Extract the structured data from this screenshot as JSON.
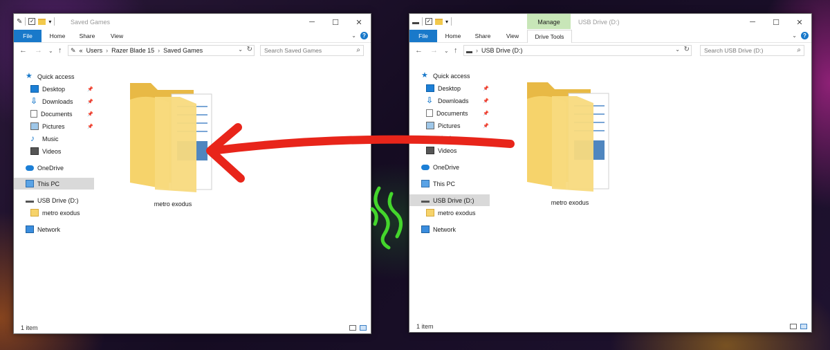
{
  "left_window": {
    "title": "Saved Games",
    "tabs": {
      "file": "File",
      "home": "Home",
      "share": "Share",
      "view": "View"
    },
    "address": {
      "overflow": "«",
      "segments": [
        "Users",
        "Razer Blade 15",
        "Saved Games"
      ]
    },
    "search_placeholder": "Search Saved Games",
    "nav": {
      "quick_access": "Quick access",
      "desktop": "Desktop",
      "downloads": "Downloads",
      "documents": "Documents",
      "pictures": "Pictures",
      "music": "Music",
      "videos": "Videos",
      "onedrive": "OneDrive",
      "this_pc": "This PC",
      "usb_drive": "USB Drive (D:)",
      "metro_exodus": "metro exodus",
      "network": "Network"
    },
    "folder_name": "metro exodus",
    "status": "1 item"
  },
  "right_window": {
    "title": "USB Drive (D:)",
    "tabs": {
      "file": "File",
      "home": "Home",
      "share": "Share",
      "view": "View",
      "manage": "Manage",
      "drive_tools": "Drive Tools"
    },
    "address": {
      "segments": [
        "USB Drive (D:)"
      ]
    },
    "search_placeholder": "Search USB Drive (D:)",
    "nav": {
      "quick_access": "Quick access",
      "desktop": "Desktop",
      "downloads": "Downloads",
      "documents": "Documents",
      "pictures": "Pictures",
      "music": "Music",
      "videos": "Videos",
      "onedrive": "OneDrive",
      "this_pc": "This PC",
      "usb_drive": "USB Drive (D:)",
      "metro_exodus": "metro exodus",
      "network": "Network"
    },
    "folder_name": "metro exodus",
    "status": "1 item"
  },
  "colors": {
    "accent": "#1979ca",
    "manage_tab": "#c8e6b8",
    "arrow": "#e8251a",
    "folder": "#f6d36b",
    "razer_green": "#44d62c"
  }
}
